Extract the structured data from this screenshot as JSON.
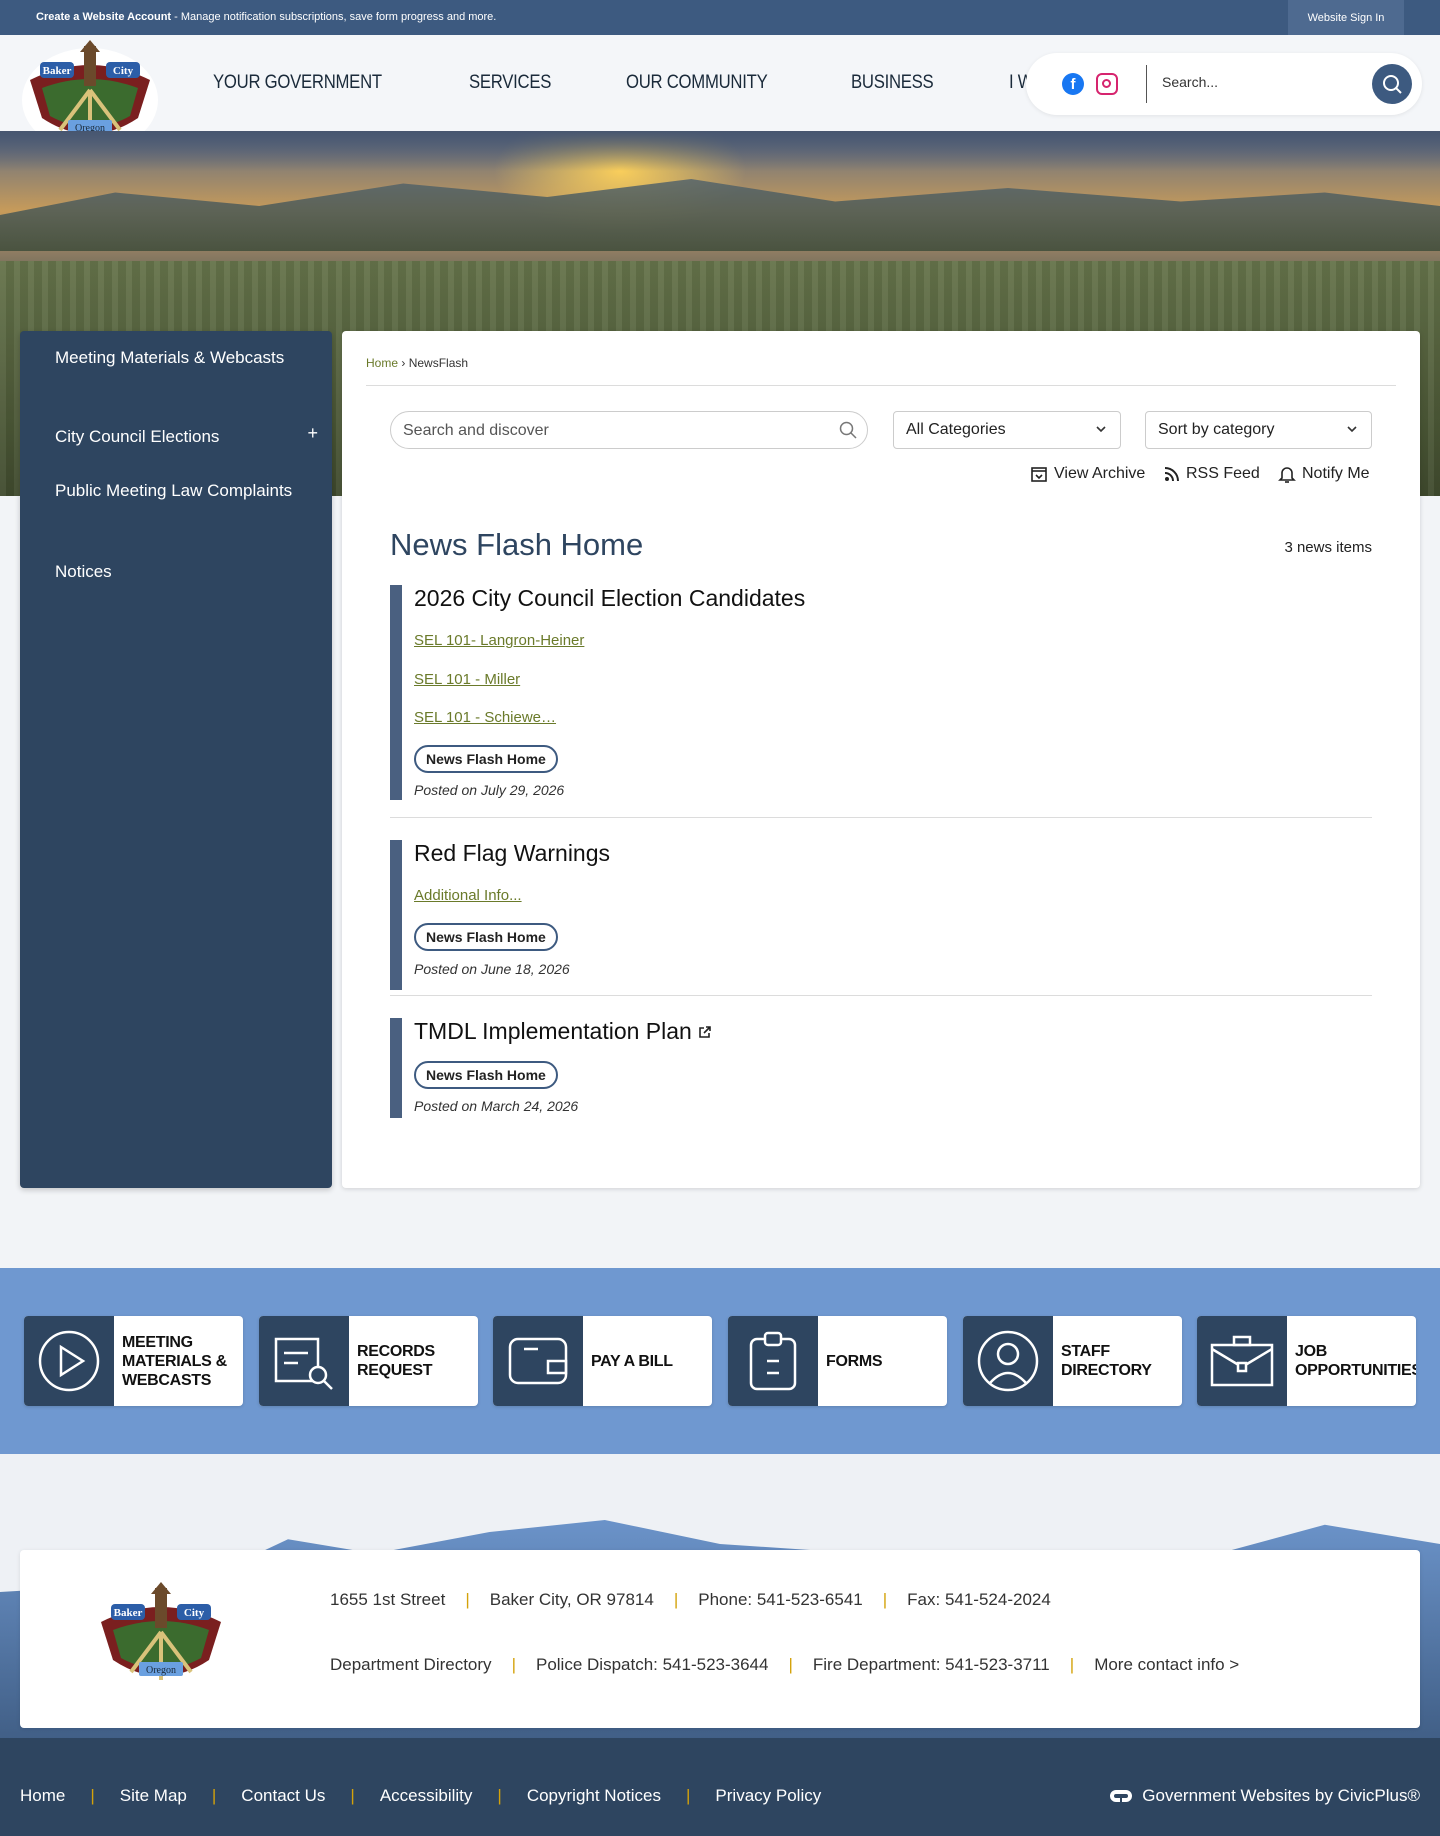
{
  "topbar": {
    "create_bold": "Create a Website Account",
    "create_rest": " - Manage notification subscriptions, save form progress and more.",
    "sign_in": "Website Sign In"
  },
  "logo": {
    "line1": "Baker",
    "line2": "City",
    "line3": "Oregon"
  },
  "nav": {
    "items": [
      "YOUR GOVERNMENT",
      "SERVICES",
      "OUR COMMUNITY",
      "BUSINESS",
      "I WANT TO..."
    ]
  },
  "header_search": {
    "placeholder": "Search...",
    "icon": "search-icon"
  },
  "social": {
    "facebook": "facebook-icon",
    "instagram": "instagram-icon"
  },
  "sidebar": {
    "items": [
      "Meeting Materials & Webcasts",
      "City Council Elections",
      "Public Meeting Law Complaints",
      "Notices"
    ],
    "expand_glyph": "+"
  },
  "breadcrumb": {
    "home": "Home",
    "current": "› NewsFlash"
  },
  "filters": {
    "search_placeholder": "Search and discover",
    "category": "All Categories",
    "sort": "Sort by category"
  },
  "tools": {
    "archive": "View Archive",
    "rss": "RSS Feed",
    "notify": "Notify Me"
  },
  "news": {
    "heading": "News Flash Home",
    "count": "3 news items",
    "items": [
      {
        "title": "2026 City Council Election Candidates",
        "links": [
          "SEL 101- Langron-Heiner",
          "SEL 101 - Miller",
          "SEL 101 - Schiewe…"
        ],
        "category": "News Flash Home",
        "posted": "Posted on July 29, 2026"
      },
      {
        "title": "Red Flag Warnings",
        "links": [
          "Additional Info..."
        ],
        "category": "News Flash Home",
        "posted": "Posted on June 18, 2026"
      },
      {
        "title": "TMDL Implementation Plan",
        "links": [],
        "category": "News Flash Home",
        "posted": "Posted on March 24, 2026"
      }
    ]
  },
  "quick_links": [
    {
      "label": "MEETING MATERIALS & WEBCASTS",
      "icon": "play-icon"
    },
    {
      "label": "RECORDS REQUEST",
      "icon": "document-search-icon"
    },
    {
      "label": "PAY A BILL",
      "icon": "wallet-icon"
    },
    {
      "label": "FORMS",
      "icon": "clipboard-icon"
    },
    {
      "label": "STAFF DIRECTORY",
      "icon": "person-icon"
    },
    {
      "label": "JOB OPPORTUNITIES",
      "icon": "briefcase-icon"
    }
  ],
  "footer": {
    "row1": [
      "1655 1st Street",
      "Baker City, OR 97814",
      "Phone: 541-523-6541",
      "Fax: 541-524-2024"
    ],
    "row2": [
      "Department Directory",
      "Police Dispatch: 541-523-3644",
      "Fire Department: 541-523-3711",
      "More contact info >"
    ],
    "bottom_links": [
      "Home",
      "Site Map",
      "Contact Us",
      "Accessibility",
      "Copyright Notices",
      "Privacy Policy"
    ],
    "civicplus": "Government Websites by CivicPlus®"
  },
  "colors": {
    "navy": "#2e4560",
    "topbar": "#3d5a80",
    "quicklinks_band": "#6f98d0",
    "link_olive": "#6a7a2a",
    "pipe_gold": "#d4a20a"
  }
}
